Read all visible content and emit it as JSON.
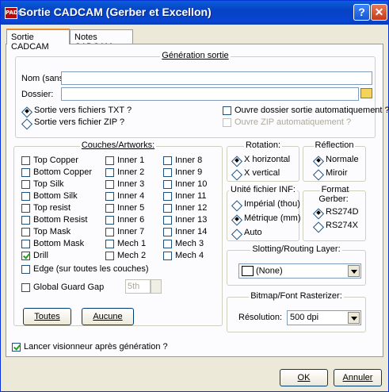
{
  "window": {
    "title": "Sortie CADCAM (Gerber et Excellon)",
    "icon": "app-icon",
    "help_label": "?",
    "close_label": "✕"
  },
  "tabs": [
    {
      "label": "Sortie CADCAM"
    },
    {
      "label": "Notes CADCAM"
    }
  ],
  "generation": {
    "title": "Génération sortie",
    "nom_label": "Nom (sans",
    "nom_value": "",
    "dossier_label": "Dossier:",
    "dossier_value": "",
    "folder_icon": "folder-icon",
    "txt_label": "Sortie vers fichiers TXT ?",
    "zip_label": "Sortie vers fichier ZIP ?",
    "open_auto_label": "Ouvre dossier sortie automatiquement ?",
    "open_zip_label": "Ouvre ZIP automatiquement ?"
  },
  "layers": {
    "title": "Couches/Artworks:",
    "col1": [
      {
        "label": "Top Copper",
        "checked": false
      },
      {
        "label": "Bottom Copper",
        "checked": false
      },
      {
        "label": "Top Silk",
        "checked": false
      },
      {
        "label": "Bottom Silk",
        "checked": false
      },
      {
        "label": "Top resist",
        "checked": false
      },
      {
        "label": "Bottom Resist",
        "checked": false
      },
      {
        "label": "Top Mask",
        "checked": false
      },
      {
        "label": "Bottom Mask",
        "checked": false
      },
      {
        "label": "Drill",
        "checked": true
      }
    ],
    "col2": [
      {
        "label": "Inner 1"
      },
      {
        "label": "Inner 2"
      },
      {
        "label": "Inner 3"
      },
      {
        "label": "Inner 4"
      },
      {
        "label": "Inner 5"
      },
      {
        "label": "Inner 6"
      },
      {
        "label": "Inner 7"
      },
      {
        "label": "Mech 1"
      },
      {
        "label": "Mech 2"
      }
    ],
    "col3": [
      {
        "label": "Inner 8"
      },
      {
        "label": "Inner 9"
      },
      {
        "label": "Inner 10"
      },
      {
        "label": "Inner 11"
      },
      {
        "label": "Inner 12"
      },
      {
        "label": "Inner 13"
      },
      {
        "label": "Inner 14"
      },
      {
        "label": "Mech 3"
      },
      {
        "label": "Mech 4"
      }
    ],
    "edge_label": "Edge (sur toutes les couches)",
    "guard_label": "Global Guard Gap",
    "guard_value": "5th",
    "all_button": "Toutes",
    "none_button": "Aucune"
  },
  "rotation": {
    "title": "Rotation:",
    "opt1": "X horizontal",
    "opt2": "X vertical"
  },
  "reflection": {
    "title": "Réflection",
    "opt1": "Normale",
    "opt2": "Miroir"
  },
  "units": {
    "title": "Unité fichier INF:",
    "opt1": "Impérial (thou)",
    "opt2": "Métrique (mm)",
    "opt3": "Auto"
  },
  "format": {
    "title": "Format Gerber:",
    "opt1": "RS274D",
    "opt2": "RS274X"
  },
  "slotting": {
    "title": "Slotting/Routing Layer:",
    "value": "(None)"
  },
  "bitmap": {
    "title": "Bitmap/Font Rasterizer:",
    "res_label": "Résolution:",
    "res_value": "500 dpi"
  },
  "launch_label": "Lancer visionneur après génération ?",
  "ok_button": "OK",
  "cancel_button": "Annuler"
}
